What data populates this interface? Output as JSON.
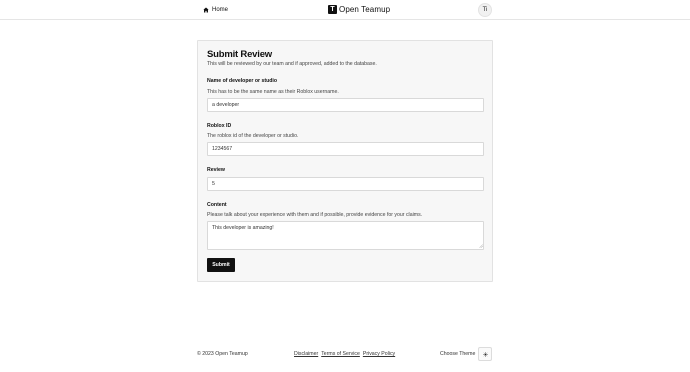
{
  "header": {
    "home_label": "Home",
    "home_icon": "home-icon",
    "brand_mark": "T",
    "brand_name": "Open Teamup",
    "avatar_initials": "Ti"
  },
  "form": {
    "title": "Submit Review",
    "subtitle": "This will be reviewed by our team and if approved, added to the database.",
    "fields": {
      "name": {
        "label": "Name of developer or studio",
        "help": "This has to be the same name as their Roblox username.",
        "value": "a developer"
      },
      "roblox_id": {
        "label": "Roblox ID",
        "help": "The roblox id of the developer or studio.",
        "value": "1234567"
      },
      "review": {
        "label": "Review",
        "value": "5"
      },
      "content": {
        "label": "Content",
        "help": "Please talk about your experience with them and if possible, provide evidence for your claims.",
        "value": "This developer is amazing!"
      }
    },
    "submit_label": "Submit"
  },
  "footer": {
    "copyright": "© 2023 Open Teamup",
    "links": [
      "Disclaimer",
      "Terms of Service",
      "Privacy Policy"
    ],
    "theme_label": "Choose Theme",
    "theme_icon": "sun-icon"
  }
}
